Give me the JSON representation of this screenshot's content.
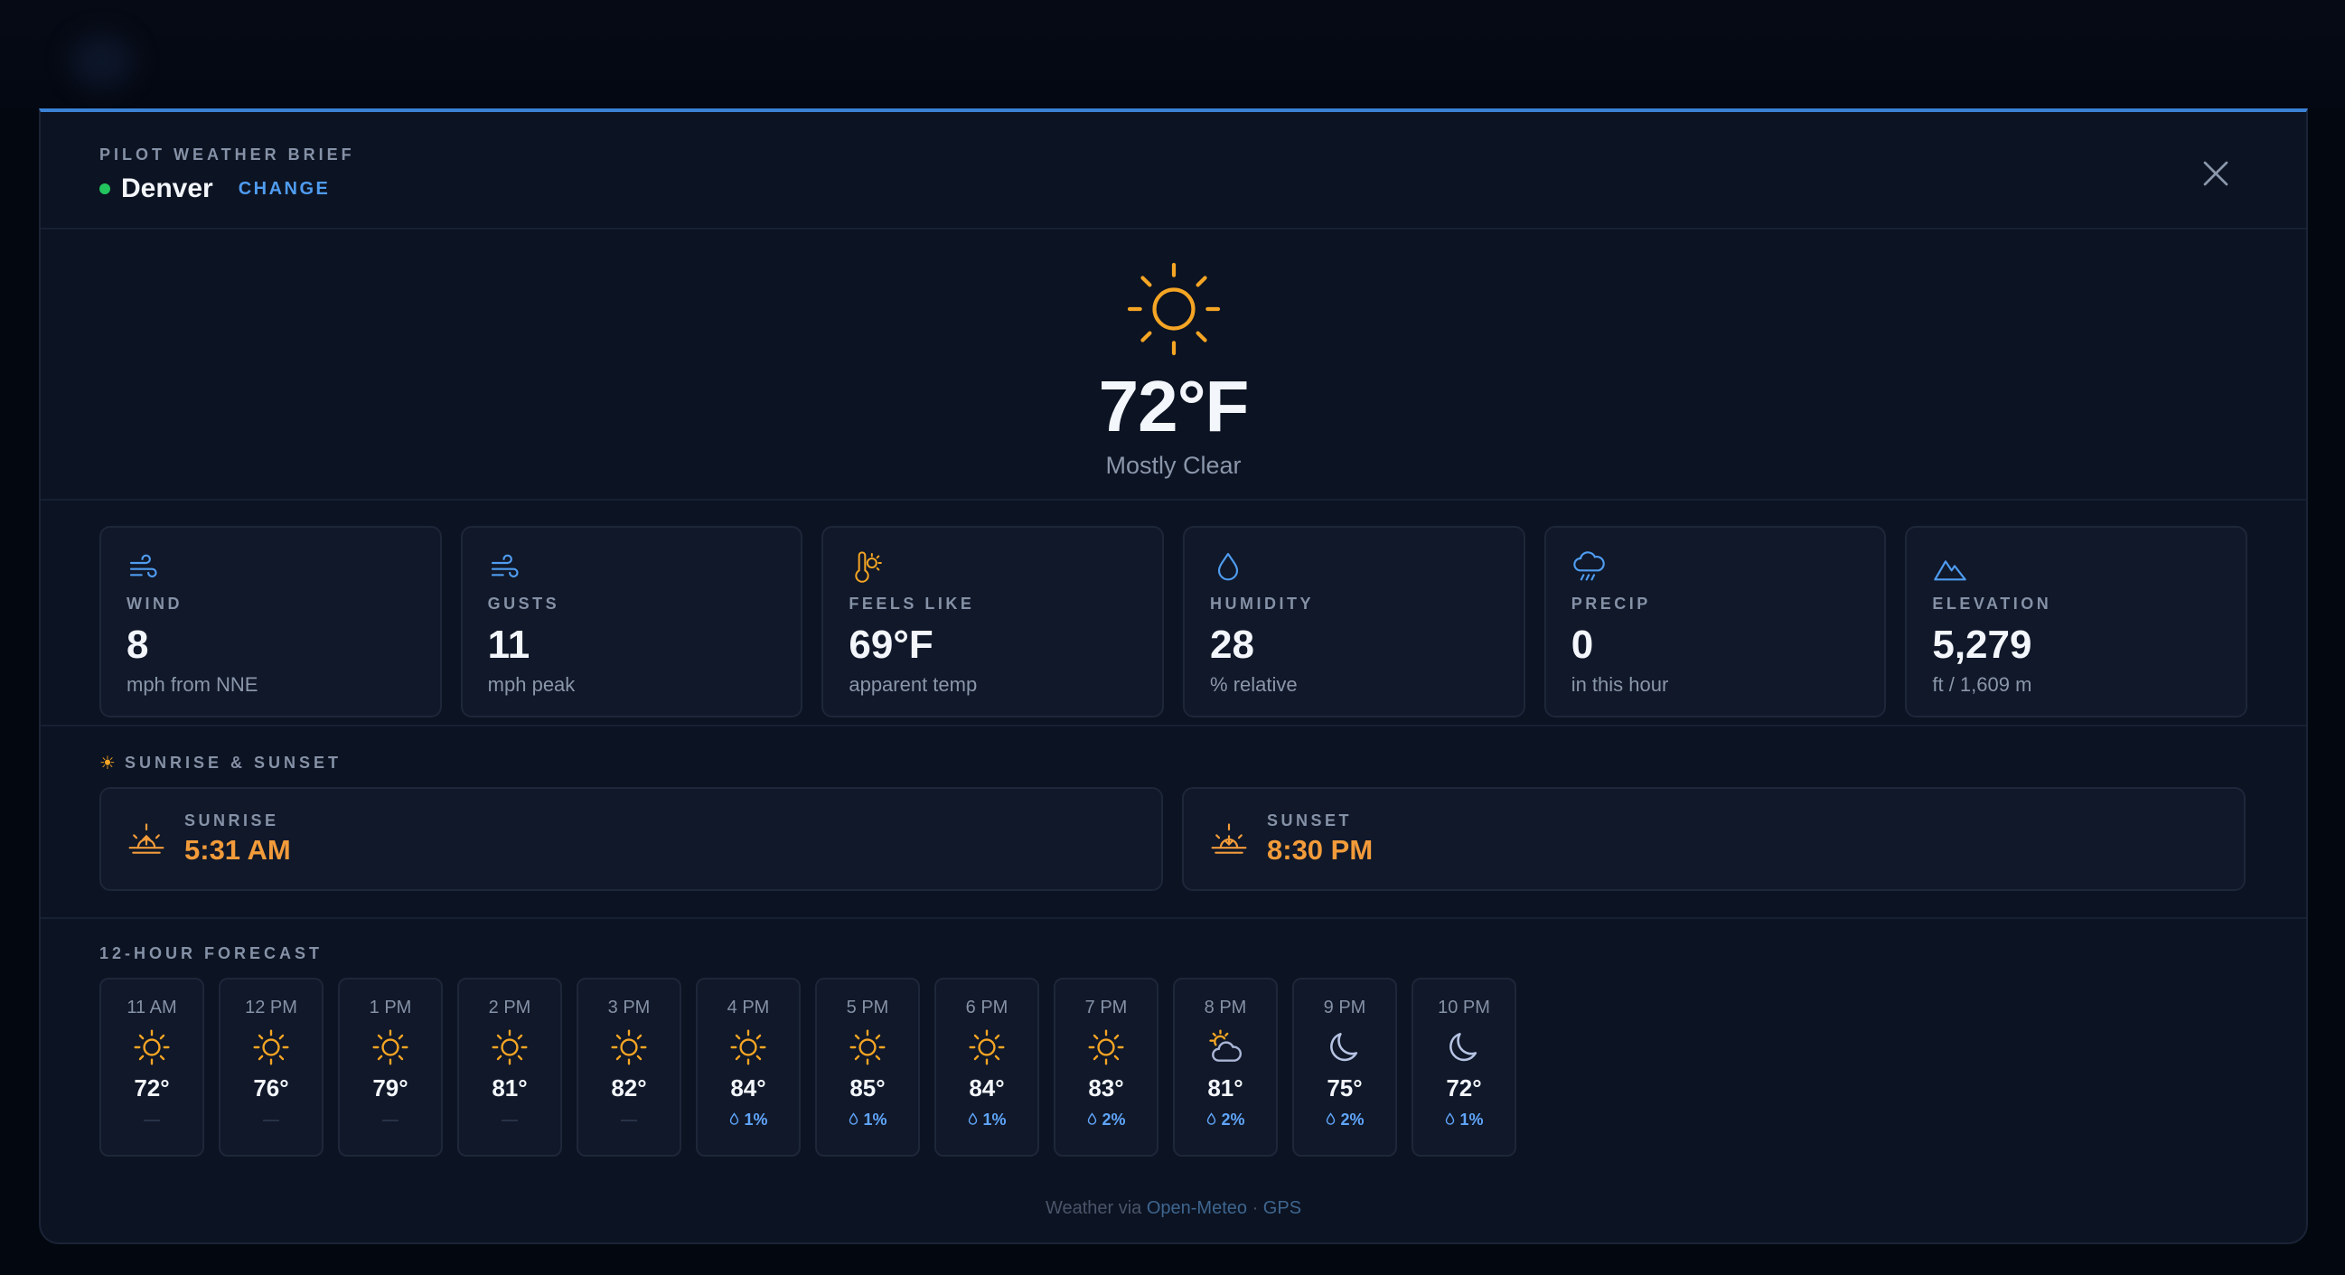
{
  "header": {
    "eyebrow": "PILOT WEATHER BRIEF",
    "location": "Denver",
    "change_label": "CHANGE"
  },
  "current": {
    "temperature": "72°F",
    "condition": "Mostly Clear",
    "icon": "sun-icon"
  },
  "stats": [
    {
      "icon": "wind-icon",
      "label": "WIND",
      "value": "8",
      "sub": "mph from NNE"
    },
    {
      "icon": "gusts-icon",
      "label": "GUSTS",
      "value": "11",
      "sub": "mph peak"
    },
    {
      "icon": "thermometer-sun-icon",
      "label": "FEELS LIKE",
      "value": "69°F",
      "sub": "apparent temp"
    },
    {
      "icon": "droplet-icon",
      "label": "HUMIDITY",
      "value": "28",
      "sub": "% relative"
    },
    {
      "icon": "cloud-rain-icon",
      "label": "PRECIP",
      "value": "0",
      "sub": "in this hour"
    },
    {
      "icon": "mountain-icon",
      "label": "ELEVATION",
      "value": "5,279",
      "sub": "ft / 1,609 m"
    }
  ],
  "sun": {
    "title": "SUNRISE & SUNSET",
    "sunrise_label": "SUNRISE",
    "sunrise_time": "5:31 AM",
    "sunset_label": "SUNSET",
    "sunset_time": "8:30 PM"
  },
  "forecast": {
    "title": "12-HOUR FORECAST",
    "hours": [
      {
        "time": "11 AM",
        "icon": "sun-icon",
        "temp": "72°",
        "precip": "—"
      },
      {
        "time": "12 PM",
        "icon": "sun-icon",
        "temp": "76°",
        "precip": "—"
      },
      {
        "time": "1 PM",
        "icon": "sun-icon",
        "temp": "79°",
        "precip": "—"
      },
      {
        "time": "2 PM",
        "icon": "sun-icon",
        "temp": "81°",
        "precip": "—"
      },
      {
        "time": "3 PM",
        "icon": "sun-icon",
        "temp": "82°",
        "precip": "—"
      },
      {
        "time": "4 PM",
        "icon": "sun-icon",
        "temp": "84°",
        "precip": "1%"
      },
      {
        "time": "5 PM",
        "icon": "sun-icon",
        "temp": "85°",
        "precip": "1%"
      },
      {
        "time": "6 PM",
        "icon": "sun-icon",
        "temp": "84°",
        "precip": "1%"
      },
      {
        "time": "7 PM",
        "icon": "sun-icon",
        "temp": "83°",
        "precip": "2%"
      },
      {
        "time": "8 PM",
        "icon": "partly-cloudy-icon",
        "temp": "81°",
        "precip": "2%"
      },
      {
        "time": "9 PM",
        "icon": "moon-icon",
        "temp": "75°",
        "precip": "2%"
      },
      {
        "time": "10 PM",
        "icon": "moon-icon",
        "temp": "72°",
        "precip": "1%"
      }
    ]
  },
  "footer": {
    "prefix": "Weather via ",
    "source": "Open-Meteo",
    "separator": " · ",
    "mode": "GPS"
  },
  "colors": {
    "accent": "#3b82d6",
    "sun": "#f5a524",
    "sun_times": "#f29b3a",
    "status_dot": "#22c55e",
    "precip": "#60a5fa",
    "background": "#0c1322"
  }
}
